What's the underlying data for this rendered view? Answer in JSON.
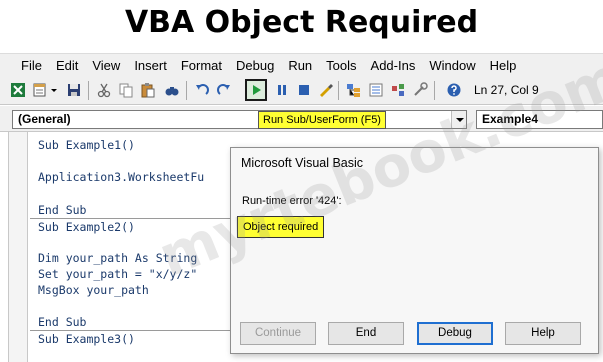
{
  "heading": "VBA Object Required",
  "menu": [
    "File",
    "Edit",
    "View",
    "Insert",
    "Format",
    "Debug",
    "Run",
    "Tools",
    "Add-Ins",
    "Window",
    "Help"
  ],
  "toolbar": {
    "cursor_position": "Ln 27, Col 9",
    "icons": [
      "excel-icon",
      "insert-module-icon",
      "save-icon",
      "cut-icon",
      "copy-icon",
      "paste-icon",
      "find-icon",
      "undo-icon",
      "redo-icon",
      "run-icon",
      "break-icon",
      "reset-icon",
      "design-mode-icon",
      "project-explorer-icon",
      "properties-icon",
      "object-browser-icon",
      "toolbox-icon"
    ]
  },
  "procedure_bar": {
    "object_combo": "(General)",
    "procedure_combo": "Example4",
    "tooltip": "Run Sub/UserForm (F5)"
  },
  "code": {
    "lines": [
      "Sub Example1()",
      "Application3.WorksheetFu",
      "End Sub",
      "Sub Example2()",
      "Dim your_path As String",
      "Set your_path = \"x/y/z\"",
      "MsgBox your_path",
      "End Sub",
      "Sub Example3()"
    ]
  },
  "dialog": {
    "title": "Microsoft Visual Basic",
    "error": "Run-time error '424':",
    "message": "Object required",
    "buttons": [
      "Continue",
      "End",
      "Debug",
      "Help"
    ]
  },
  "watermark": "myrtebook.com",
  "colors": {
    "highlight": "#ffff33",
    "run_green": "#1f9a3b",
    "code_blue": "#1b3a6b",
    "default_button_border": "#1f6fd1"
  }
}
